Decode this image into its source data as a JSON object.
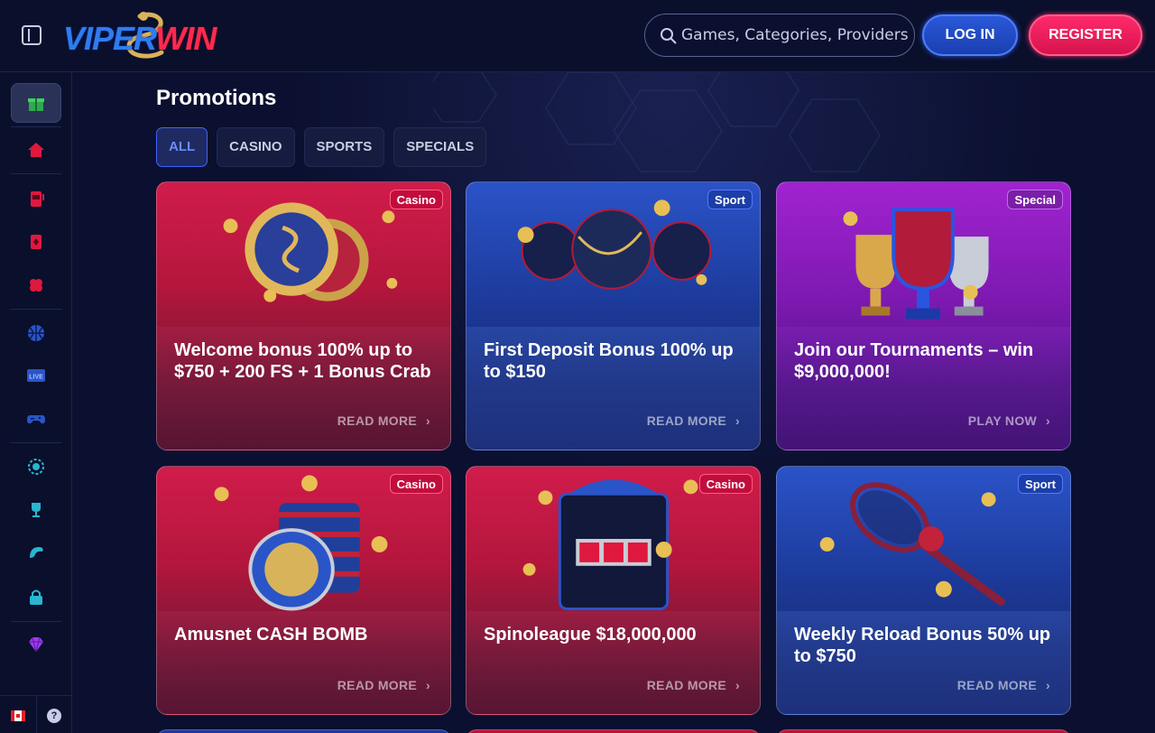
{
  "header": {
    "logo_viper": "VIPER",
    "logo_win": "WIN",
    "search_placeholder": "Games, Categories, Providers",
    "login_label": "LOG IN",
    "register_label": "REGISTER"
  },
  "sidebar": {
    "items": [
      {
        "icon": "gift-icon"
      },
      {
        "icon": "home-icon"
      },
      {
        "icon": "slot-machine-icon"
      },
      {
        "icon": "cards-icon"
      },
      {
        "icon": "clover-icon"
      },
      {
        "icon": "basketball-icon"
      },
      {
        "icon": "live-icon",
        "text": "LIVE"
      },
      {
        "icon": "gamepad-icon"
      },
      {
        "icon": "badge-icon"
      },
      {
        "icon": "trophy-icon"
      },
      {
        "icon": "snake-icon"
      },
      {
        "icon": "lock-icon"
      },
      {
        "icon": "diamond-icon"
      }
    ],
    "help_label": "?"
  },
  "page": {
    "title": "Promotions",
    "tabs": [
      {
        "label": "ALL",
        "active": true
      },
      {
        "label": "CASINO",
        "active": false
      },
      {
        "label": "SPORTS",
        "active": false
      },
      {
        "label": "SPECIALS",
        "active": false
      }
    ]
  },
  "promotions": [
    {
      "badge": "Casino",
      "title": "Welcome bonus 100% up to $750 + 200 FS + 1 Bonus Crab",
      "cta": "READ MORE"
    },
    {
      "badge": "Sport",
      "title": "First Deposit Bonus 100% up to $150",
      "cta": "READ MORE"
    },
    {
      "badge": "Special",
      "title": "Join our Tournaments – win $9,000,000!",
      "cta": "PLAY NOW"
    },
    {
      "badge": "Casino",
      "title": "Amusnet CASH BOMB",
      "cta": "READ MORE"
    },
    {
      "badge": "Casino",
      "title": "Spinoleague $18,000,000",
      "cta": "READ MORE"
    },
    {
      "badge": "Sport",
      "title": "Weekly Reload Bonus 50% up to $750",
      "cta": "READ MORE"
    }
  ],
  "colors": {
    "background": "#0b1030",
    "accent_blue": "#2a58d8",
    "accent_red": "#ff2a6a"
  }
}
